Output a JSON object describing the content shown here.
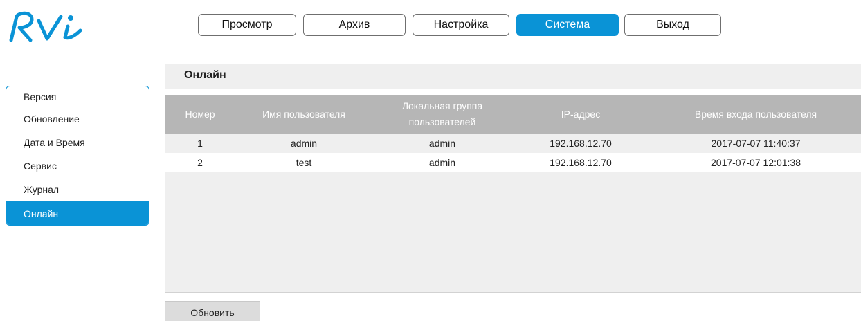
{
  "logo": {
    "text": "RVi"
  },
  "topnav": {
    "items": [
      {
        "label": "Просмотр",
        "active": false
      },
      {
        "label": "Архив",
        "active": false
      },
      {
        "label": "Настройка",
        "active": false
      },
      {
        "label": "Система",
        "active": true
      },
      {
        "label": "Выход",
        "active": false
      }
    ]
  },
  "sidebar": {
    "items": [
      {
        "label": "Версия",
        "active": false
      },
      {
        "label": "Обновление",
        "active": false
      },
      {
        "label": "Дата и Время",
        "active": false
      },
      {
        "label": "Сервис",
        "active": false
      },
      {
        "label": "Журнал",
        "active": false
      },
      {
        "label": "Онлайн",
        "active": true
      }
    ]
  },
  "main": {
    "title": "Онлайн",
    "table": {
      "columns": [
        "Номер",
        "Имя пользователя",
        "Локальная группа пользователей",
        "IP-адрес",
        "Время входа пользователя"
      ],
      "rows": [
        [
          "1",
          "admin",
          "admin",
          "192.168.12.70",
          "2017-07-07 11:40:37"
        ],
        [
          "2",
          "test",
          "admin",
          "192.168.12.70",
          "2017-07-07 12:01:38"
        ]
      ]
    },
    "refresh_label": "Обновить"
  },
  "colors": {
    "accent": "#0a93d6",
    "table_header": "#b6b6b6",
    "panel_bg": "#efefef"
  }
}
